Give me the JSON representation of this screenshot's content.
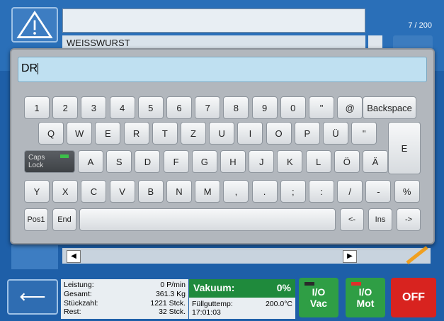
{
  "header": {
    "counter": "7 / 200",
    "product": "WEISSWURST"
  },
  "keyboard": {
    "input_value": "DR",
    "row1": [
      "1",
      "2",
      "3",
      "4",
      "5",
      "6",
      "7",
      "8",
      "9",
      "0",
      "\"",
      "@"
    ],
    "backspace": "Backspace",
    "row2": [
      "Q",
      "W",
      "E",
      "R",
      "T",
      "Z",
      "U",
      "I",
      "O",
      "P",
      "Ü",
      "\""
    ],
    "enter": "E",
    "caps": "Caps Lock",
    "row3": [
      "A",
      "S",
      "D",
      "F",
      "G",
      "H",
      "J",
      "K",
      "L",
      "Ö",
      "Ä"
    ],
    "row4": [
      "Y",
      "X",
      "C",
      "V",
      "B",
      "N",
      "M",
      ",",
      ".",
      ";",
      ":",
      "/",
      "-",
      "%"
    ],
    "pos1": "Pos1",
    "end": "End",
    "left": "<-",
    "ins": "Ins",
    "right": "->"
  },
  "status": {
    "leistung_label": "Leistung:",
    "leistung_value": "0 P/min",
    "gesamt_label": "Gesamt:",
    "gesamt_value": "361.3 Kg",
    "stueck_label": "Stückzahl:",
    "stueck_value": "1221 Stck.",
    "rest_label": "Rest:",
    "rest_value": "32 Stck.",
    "vakuum_label": "Vakuum:",
    "vakuum_value": "0%",
    "fuell_label": "Füllguttemp:",
    "fuell_value": "200.0°C",
    "time": "17:01:03"
  },
  "buttons": {
    "io_vac_1": "I/O",
    "io_vac_2": "Vac",
    "io_mot_1": "I/O",
    "io_mot_2": "Mot",
    "off": "OFF"
  },
  "colors": {
    "accent": "#1e5fa8",
    "vakuum": "#1f8a3c",
    "off": "#d8231f"
  }
}
